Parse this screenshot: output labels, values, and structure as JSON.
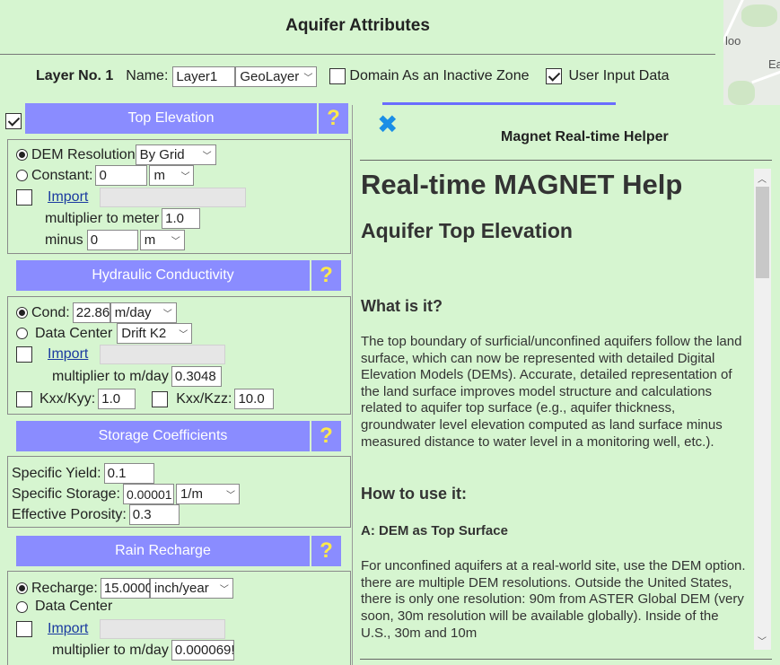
{
  "page_title": "Aquifer Attributes",
  "map": {
    "labels": [
      "loo",
      "Ea"
    ]
  },
  "layer": {
    "label": "Layer No. 1",
    "name_label": "Name:",
    "name_value": "Layer1",
    "type_value": "GeoLayer",
    "inactive_label": "Domain As an Inactive Zone",
    "inactive_checked": false,
    "user_input_label": "User Input Data",
    "user_input_checked": true
  },
  "top_elevation": {
    "header": "Top Elevation",
    "help": "?",
    "dem_label": "DEM Resolution",
    "dem_value": "By Grid",
    "constant_label": "Constant:",
    "constant_value": "0",
    "constant_unit": "m",
    "import_label": "Import",
    "multiplier_label": "multiplier to meter",
    "multiplier_value": "1.0",
    "minus_label": "minus",
    "minus_value": "0",
    "minus_unit": "m"
  },
  "hydraulic": {
    "header": "Hydraulic Conductivity",
    "help": "?",
    "cond_label": "Cond:",
    "cond_value": "22.86",
    "cond_unit": "m/day",
    "datacenter_label": "Data Center",
    "datacenter_value": "Drift K2",
    "import_label": "Import",
    "multiplier_label": "multiplier to m/day",
    "multiplier_value": "0.3048",
    "kxky_label": "Kxx/Kyy:",
    "kxky_value": "1.0",
    "kxkz_label": "Kxx/Kzz:",
    "kxkz_value": "10.0"
  },
  "storage": {
    "header": "Storage Coefficients",
    "help": "?",
    "yield_label": "Specific Yield:",
    "yield_value": "0.1",
    "storage_label": "Specific Storage:",
    "storage_value": "0.00001",
    "storage_unit": "1/m",
    "porosity_label": "Effective Porosity:",
    "porosity_value": "0.3"
  },
  "recharge": {
    "header": "Rain Recharge",
    "help": "?",
    "recharge_label": "Recharge:",
    "recharge_value": "15.0000",
    "recharge_unit": "inch/year",
    "datacenter_label": "Data Center",
    "import_label": "Import",
    "multiplier_label": "multiplier to m/day",
    "multiplier_value": "0.000069!"
  },
  "helper": {
    "close": "✖",
    "title": "Magnet Real-time Helper",
    "h1": "Real-time MAGNET Help",
    "h2": "Aquifer Top Elevation",
    "what_title": "What is it?",
    "what_text": "The top boundary of surficial/unconfined aquifers follow the land surface, which can now be represented with detailed Digital Elevation Models (DEMs). Accurate, detailed representation of the land surface improves model structure and calculations related to aquifer top surface (e.g., aquifer thickness, groundwater level elevation computed as land surface minus measured distance to water level in a monitoring well, etc.).",
    "how_title": "How to use it:",
    "dem_title": "A: DEM as Top Surface",
    "dem_text": "For unconfined aquifers at a real-world site, use the DEM option. there are multiple DEM resolutions. Outside the United States, there is only one resolution: 90m from ASTER Global DEM (very soon, 30m resolution will be available globally). Inside of the U.S., 30m and 10m"
  }
}
